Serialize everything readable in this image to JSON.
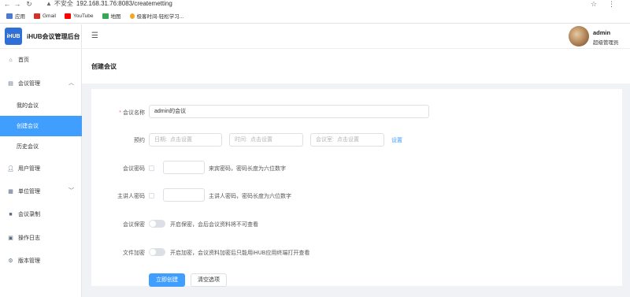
{
  "browser": {
    "security_label": "不安全",
    "url": "192.168.31.76:8083/createmetting",
    "bookmarks": [
      {
        "label": "应用",
        "color": "#4a7bd0"
      },
      {
        "label": "Gmail",
        "color": "#d93025"
      },
      {
        "label": "YouTube",
        "color": "#ff0000"
      },
      {
        "label": "地图",
        "color": "#34a853"
      },
      {
        "label": "极客时间-轻松学习...",
        "color": "#f5a623"
      }
    ]
  },
  "sidebar": {
    "logo_badge": "iHUB",
    "logo_text": "iHUB会议管理后台",
    "items": [
      {
        "label": "首页",
        "icon": "home-icon"
      },
      {
        "label": "会议管理",
        "icon": "meeting-icon"
      },
      {
        "label": "我的会议"
      },
      {
        "label": "创建会议"
      },
      {
        "label": "历史会议"
      },
      {
        "label": "用户管理",
        "icon": "user-icon"
      },
      {
        "label": "单位管理",
        "icon": "org-icon"
      },
      {
        "label": "会议录制",
        "icon": "video-icon"
      },
      {
        "label": "操作日志",
        "icon": "log-icon"
      },
      {
        "label": "版本管理",
        "icon": "version-icon"
      }
    ]
  },
  "header": {
    "user_name": "admin",
    "user_role": "超级管理员"
  },
  "page": {
    "title": "创建会议"
  },
  "form": {
    "meeting_name_label": "会议名称",
    "meeting_name_value": "admin的会议",
    "appointment_label": "预约",
    "date_prefix": "日期:",
    "date_placeholder": "点击设置",
    "time_prefix": "时间:",
    "time_placeholder": "点击设置",
    "duration_prefix": "会议室:",
    "duration_placeholder": "点击设置",
    "settings_link": "设置",
    "password_label": "会议密码",
    "password_hint": "来宾密码，密码长度为六位数字",
    "host_password_label": "主讲人密码",
    "host_password_hint": "主讲人密码，密码长度为六位数字",
    "confidential_label": "会议保密",
    "confidential_hint": "开启保密，会后会议资料将不可查看",
    "encrypt_label": "文件加密",
    "encrypt_hint": "开启加密，会议资料加密后只能用iHUB应用终端打开查看"
  },
  "actions": {
    "create_label": "立即创建",
    "clear_label": "清空选项"
  },
  "colors": {
    "accent": "#409eff",
    "logo": "#2f6fd6",
    "required": "#f56c6c"
  }
}
